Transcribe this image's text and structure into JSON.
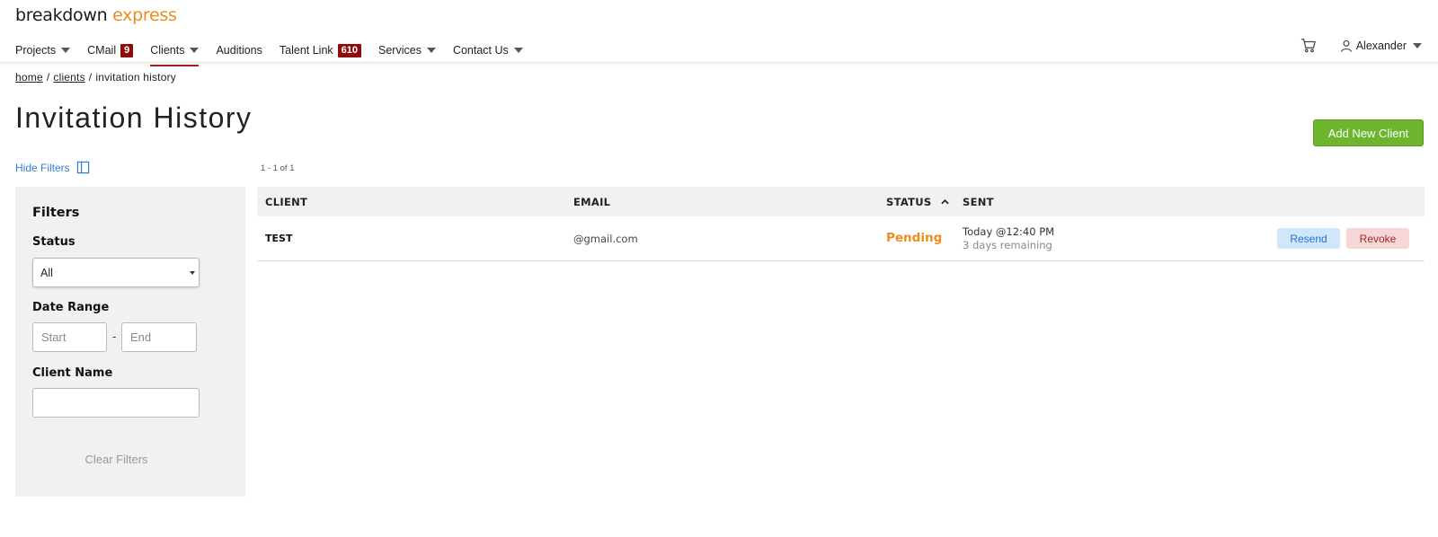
{
  "brand": {
    "part1": "breakdown",
    "part2": "express"
  },
  "nav": {
    "items": [
      {
        "label": "Projects",
        "caret": true
      },
      {
        "label": "CMail",
        "badge": "9"
      },
      {
        "label": "Clients",
        "caret": true,
        "active": true
      },
      {
        "label": "Auditions"
      },
      {
        "label": "Talent Link",
        "badge": "610"
      },
      {
        "label": "Services",
        "caret": true
      },
      {
        "label": "Contact Us",
        "caret": true
      }
    ],
    "user": "Alexander"
  },
  "breadcrumb": {
    "home": "home",
    "clients": "clients",
    "current": "invitation history",
    "sep": "/"
  },
  "page": {
    "title": "Invitation History",
    "add_button": "Add New Client"
  },
  "filters": {
    "toggle_label": "Hide Filters",
    "heading": "Filters",
    "status_label": "Status",
    "status_value": "All",
    "date_label": "Date Range",
    "start_placeholder": "Start",
    "date_sep": "-",
    "end_placeholder": "End",
    "client_name_label": "Client Name",
    "client_name_value": "",
    "clear_label": "Clear Filters"
  },
  "table": {
    "count": "1 - 1 of 1",
    "headers": {
      "client": "CLIENT",
      "email": "EMAIL",
      "status": "STATUS",
      "sent": "SENT"
    },
    "rows": [
      {
        "client": "TEST",
        "email": "@gmail.com",
        "status": "Pending",
        "sent": "Today @12:40 PM",
        "remaining": "3 days remaining",
        "resend": "Resend",
        "revoke": "Revoke"
      }
    ]
  },
  "colors": {
    "accent_orange": "#ee8c1d",
    "brand_red": "#8d0b0b",
    "primary_green": "#6cb52d",
    "link_blue": "#2f7fd1"
  }
}
